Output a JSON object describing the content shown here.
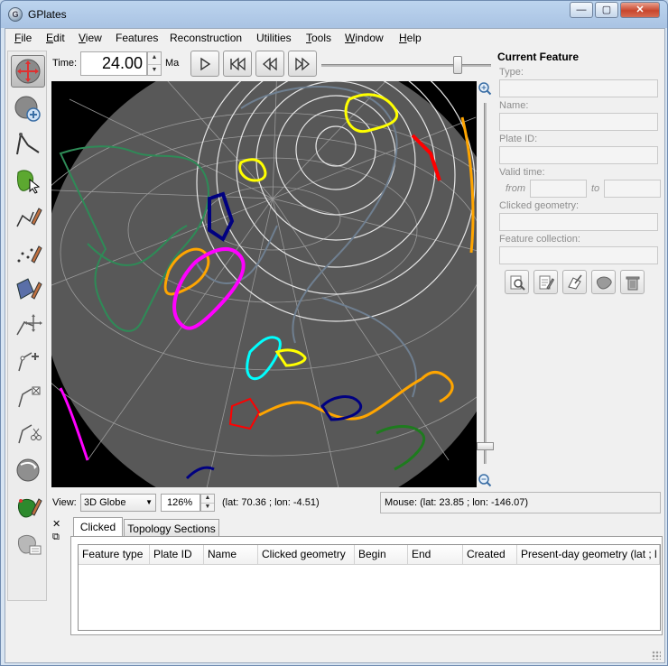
{
  "window": {
    "title": "GPlates",
    "app_icon_letter": "G",
    "min_glyph": "—",
    "max_glyph": "▢",
    "close_glyph": "✕"
  },
  "menu": [
    "File",
    "Edit",
    "View",
    "Features",
    "Reconstruction",
    "Utilities",
    "Tools",
    "Window",
    "Help"
  ],
  "menu_underline": [
    "F",
    "E",
    "V",
    "",
    "",
    "",
    "T",
    "W",
    "H"
  ],
  "menu_rest": [
    "ile",
    "dit",
    "iew",
    "Features",
    "Reconstruction",
    "Utilities",
    "ools",
    "indow",
    "elp"
  ],
  "toolbar": {
    "tools": [
      {
        "name": "drag-globe-tool",
        "active": true
      },
      {
        "name": "zoom-globe-tool",
        "active": false
      },
      {
        "name": "measure-distance-tool",
        "active": false
      },
      {
        "name": "choose-feature-tool",
        "active": false
      },
      {
        "name": "digitise-polyline-tool",
        "active": false
      },
      {
        "name": "digitise-multipoint-tool",
        "active": false
      },
      {
        "name": "digitise-polygon-tool",
        "active": false
      },
      {
        "name": "move-vertex-tool",
        "active": false
      },
      {
        "name": "insert-vertex-tool",
        "active": false
      },
      {
        "name": "delete-vertex-tool",
        "active": false
      },
      {
        "name": "split-feature-tool",
        "active": false
      },
      {
        "name": "manipulate-pole-tool",
        "active": false
      },
      {
        "name": "build-topology-tool",
        "active": false
      },
      {
        "name": "edit-topology-tool",
        "active": false
      }
    ]
  },
  "timebar": {
    "time_label": "Time:",
    "time_value": "24.00",
    "unit": "Ma",
    "slider_position": 0.82
  },
  "status": {
    "view_label": "View:",
    "projection": "3D Globe",
    "zoom": "126%",
    "camera": "(lat: 70.36 ; lon: -4.51)",
    "mouse": "Mouse: (lat: 23.85 ; lon: -146.07)"
  },
  "globe": {
    "zoom_slider_position": 0.93,
    "background": "#000000",
    "sphere_color": "#585858",
    "grid_color": "#9a9a9a"
  },
  "feature_panel": {
    "title": "Current Feature",
    "type_label": "Type:",
    "name_label": "Name:",
    "plate_id_label": "Plate ID:",
    "valid_time_label": "Valid time:",
    "from_label": "from",
    "to_label": "to",
    "clicked_geometry_label": "Clicked geometry:",
    "feature_collection_label": "Feature collection:",
    "buttons": [
      "query-feature-button",
      "edit-feature-button",
      "move-pole-button",
      "clone-feature-button",
      "delete-feature-button"
    ]
  },
  "dock": {
    "close_glyph": "✕",
    "float_glyph": "⧉",
    "tabs": [
      "Clicked",
      "Topology Sections"
    ],
    "columns": [
      "Feature type",
      "Plate ID",
      "Name",
      "Clicked geometry",
      "Begin",
      "End",
      "Created",
      "Present-day geometry (lat ; l"
    ]
  }
}
